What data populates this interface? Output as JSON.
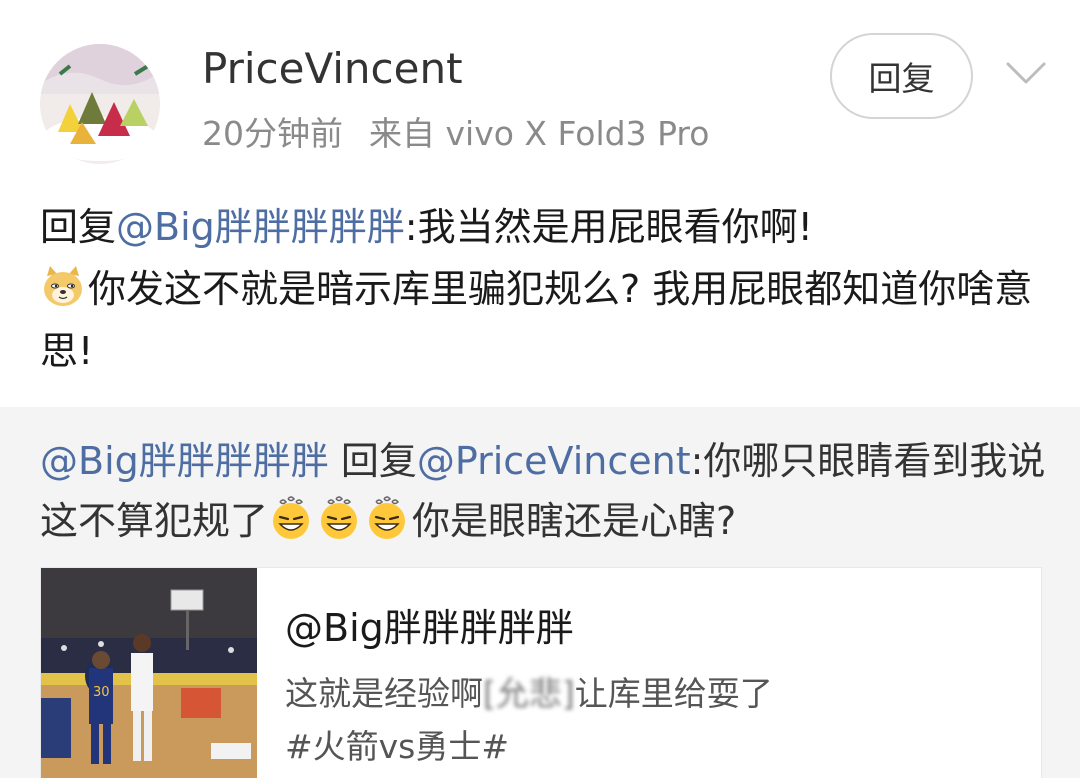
{
  "comment": {
    "username": "PriceVincent",
    "time": "20分钟前",
    "source": "来自 vivo X Fold3 Pro",
    "reply_button": "回复",
    "avatar_icon": "rice-dumpling-avatar",
    "content": {
      "prefix": "回复",
      "mention": "@Big胖胖胖胖胖",
      "text1": ":我当然是用屁眼看你啊!",
      "emoji": "doge-icon",
      "text2": "你发这不就是暗示库里骗犯规么? 我用屁眼都知道你啥意思!"
    }
  },
  "quoted": {
    "mention1": "@Big胖胖胖胖胖",
    "reply_word": " 回复",
    "mention2": "@PriceVincent",
    "text1": ":你哪只眼睛看到我说这不算犯规了",
    "emojis": [
      "dizzy-grin-icon",
      "dizzy-grin-icon",
      "dizzy-grin-icon"
    ],
    "text2": "你是眼瞎还是心瞎?"
  },
  "card": {
    "title": "@Big胖胖胖胖胖",
    "line1_before": "这就是经验啊",
    "line1_blurred": "[允悲]",
    "line1_after": "让库里给耍了",
    "line2": "#火箭vs勇士#",
    "thumbnail": "basketball-game-thumbnail"
  }
}
